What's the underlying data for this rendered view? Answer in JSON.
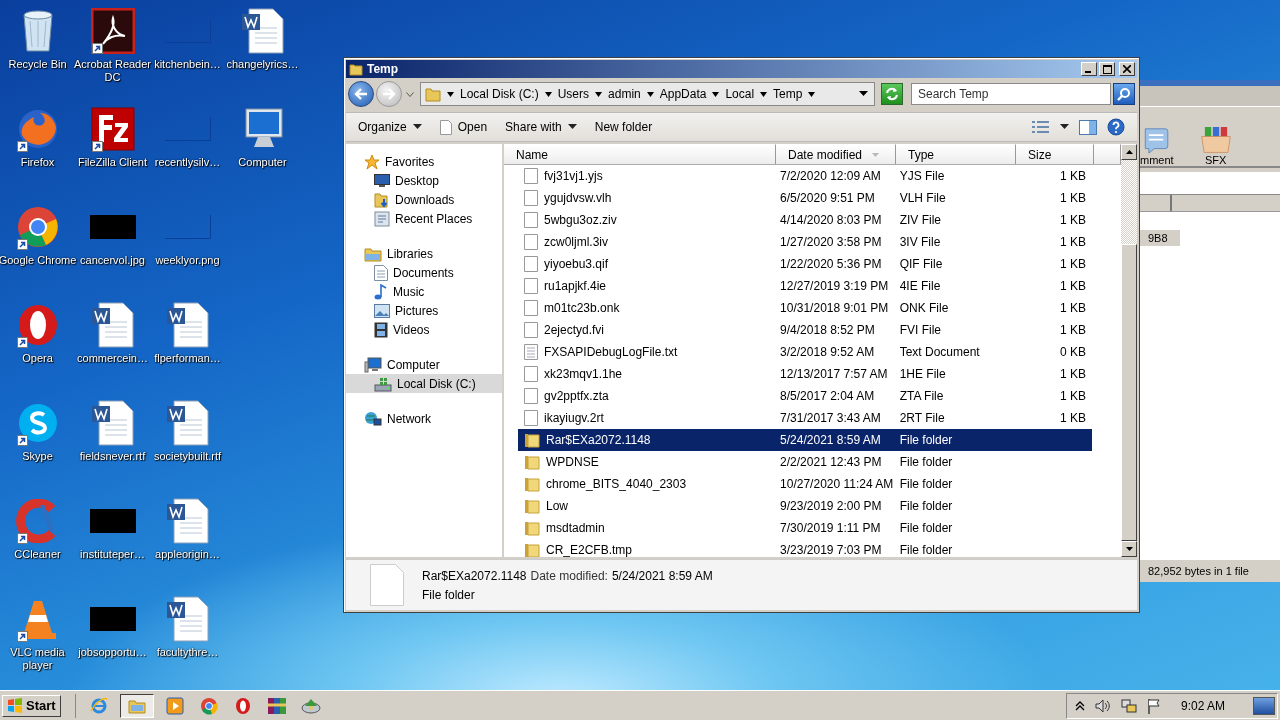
{
  "desktop": {
    "icons": [
      {
        "label": "Recycle Bin",
        "kind": "recycle",
        "shortcut": false
      },
      {
        "label": "Firefox",
        "kind": "firefox",
        "shortcut": true
      },
      {
        "label": "Google Chrome",
        "kind": "chrome",
        "shortcut": true
      },
      {
        "label": "Opera",
        "kind": "opera",
        "shortcut": true
      },
      {
        "label": "Skype",
        "kind": "skype",
        "shortcut": true
      },
      {
        "label": "CCleaner",
        "kind": "ccleaner",
        "shortcut": true
      },
      {
        "label": "VLC media player",
        "kind": "vlc",
        "shortcut": true
      },
      {
        "label": "Acrobat Reader DC",
        "kind": "pdf",
        "shortcut": true
      },
      {
        "label": "FileZilla Client",
        "kind": "filezilla",
        "shortcut": true
      },
      {
        "label": "cancervol.jpg",
        "kind": "image-dark",
        "shortcut": false
      },
      {
        "label": "commercein…",
        "kind": "word",
        "shortcut": false
      },
      {
        "label": "fieldsnever.rtf",
        "kind": "word",
        "shortcut": false
      },
      {
        "label": "instituteper…",
        "kind": "image-dark",
        "shortcut": false
      },
      {
        "label": "jobsopportu…",
        "kind": "image-dark",
        "shortcut": false
      },
      {
        "label": "kitchenbein…",
        "kind": "image-blank",
        "shortcut": false
      },
      {
        "label": "recentlysilv…",
        "kind": "image-blank",
        "shortcut": false
      },
      {
        "label": "weeklyor.png",
        "kind": "image-blank",
        "shortcut": false
      },
      {
        "label": "flperforman…",
        "kind": "word",
        "shortcut": false
      },
      {
        "label": "societybuilt.rtf",
        "kind": "word",
        "shortcut": false
      },
      {
        "label": "appleorigin…",
        "kind": "word",
        "shortcut": false
      },
      {
        "label": "facultythre…",
        "kind": "word",
        "shortcut": false
      },
      {
        "label": "changelyrics…",
        "kind": "word",
        "shortcut": false
      },
      {
        "label": "Computer",
        "kind": "computer",
        "shortcut": false
      }
    ]
  },
  "background_window": {
    "toolbar": [
      {
        "label": "mment",
        "kind": "comment"
      },
      {
        "label": "SFX",
        "kind": "sfx"
      }
    ],
    "cell": "9B8",
    "status": "82,952 bytes in 1 file"
  },
  "explorer": {
    "title": "Temp",
    "breadcrumb": [
      "Local Disk (C:)",
      "Users",
      "admin",
      "AppData",
      "Local",
      "Temp"
    ],
    "search": {
      "placeholder": "Search Temp"
    },
    "toolbar": [
      {
        "label": "Organize",
        "kind": "menu"
      },
      {
        "label": "Open",
        "kind": "open"
      },
      {
        "label": "Share with",
        "kind": "menu"
      },
      {
        "label": "New folder",
        "kind": "plain"
      }
    ],
    "nav": [
      {
        "label": "Favorites",
        "kind": "favorites",
        "selected": false,
        "children": [
          {
            "label": "Desktop",
            "kind": "desktop",
            "selected": false
          },
          {
            "label": "Downloads",
            "kind": "downloads",
            "selected": false
          },
          {
            "label": "Recent Places",
            "kind": "recent",
            "selected": false
          }
        ]
      },
      {
        "label": "Libraries",
        "kind": "libraries",
        "selected": false,
        "children": [
          {
            "label": "Documents",
            "kind": "documents",
            "selected": false
          },
          {
            "label": "Music",
            "kind": "music",
            "selected": false
          },
          {
            "label": "Pictures",
            "kind": "pictures",
            "selected": false
          },
          {
            "label": "Videos",
            "kind": "videos",
            "selected": false
          }
        ]
      },
      {
        "label": "Computer",
        "kind": "computer",
        "selected": false,
        "children": [
          {
            "label": "Local Disk (C:)",
            "kind": "disk",
            "selected": true
          }
        ]
      },
      {
        "label": "Network",
        "kind": "network",
        "selected": false
      }
    ],
    "columns": [
      {
        "label": "Name",
        "sorted": false
      },
      {
        "label": "Date modified",
        "sorted": true
      },
      {
        "label": "Type",
        "sorted": false
      },
      {
        "label": "Size",
        "sorted": false
      }
    ],
    "rows": [
      {
        "name": "fvj31vj1.yjs",
        "date": "7/2/2020 12:09 AM",
        "type": "YJS File",
        "size": "1 KB",
        "kind": "file",
        "selected": false
      },
      {
        "name": "ygujdvsw.vlh",
        "date": "6/5/2020 9:51 PM",
        "type": "VLH File",
        "size": "1 KB",
        "kind": "file",
        "selected": false
      },
      {
        "name": "5wbgu3oz.ziv",
        "date": "4/14/2020 8:03 PM",
        "type": "ZIV File",
        "size": "1 KB",
        "kind": "file",
        "selected": false
      },
      {
        "name": "zcw0ljml.3iv",
        "date": "1/27/2020 3:58 PM",
        "type": "3IV File",
        "size": "1 KB",
        "kind": "file",
        "selected": false
      },
      {
        "name": "yiyoebu3.qif",
        "date": "1/22/2020 5:36 PM",
        "type": "QIF File",
        "size": "1 KB",
        "kind": "file",
        "selected": false
      },
      {
        "name": "ru1apjkf.4ie",
        "date": "12/27/2019 3:19 PM",
        "type": "4IE File",
        "size": "1 KB",
        "kind": "file",
        "selected": false
      },
      {
        "name": "m01tc23b.onk",
        "date": "10/31/2018 9:01 PM",
        "type": "ONK File",
        "size": "1 KB",
        "kind": "file",
        "selected": false
      },
      {
        "name": "2ejectyd.fvi",
        "date": "9/4/2018 8:52 PM",
        "type": "FVI File",
        "size": "1 KB",
        "kind": "file",
        "selected": false
      },
      {
        "name": "FXSAPIDebugLogFile.txt",
        "date": "3/2/2018 9:52 AM",
        "type": "Text Document",
        "size": "0 KB",
        "kind": "text",
        "selected": false
      },
      {
        "name": "xk23mqv1.1he",
        "date": "12/13/2017 7:57 AM",
        "type": "1HE File",
        "size": "1 KB",
        "kind": "file",
        "selected": false
      },
      {
        "name": "gv2pptfx.zta",
        "date": "8/5/2017 2:04 AM",
        "type": "ZTA File",
        "size": "1 KB",
        "kind": "file",
        "selected": false
      },
      {
        "name": "ikayiugv.2rt",
        "date": "7/31/2017 3:43 AM",
        "type": "2RT File",
        "size": "1 KB",
        "kind": "file",
        "selected": false
      },
      {
        "name": "Rar$EXa2072.1148",
        "date": "5/24/2021 8:59 AM",
        "type": "File folder",
        "kind": "folder",
        "selected": true
      },
      {
        "name": "WPDNSE",
        "date": "2/2/2021 12:43 PM",
        "type": "File folder",
        "kind": "folder",
        "selected": false
      },
      {
        "name": "chrome_BITS_4040_2303",
        "date": "10/27/2020 11:24 AM",
        "type": "File folder",
        "kind": "folder",
        "selected": false
      },
      {
        "name": "Low",
        "date": "9/23/2019 2:00 PM",
        "type": "File folder",
        "kind": "folder",
        "selected": false
      },
      {
        "name": "msdtadmin",
        "date": "7/30/2019 1:11 PM",
        "type": "File folder",
        "kind": "folder",
        "selected": false
      },
      {
        "name": "CR_E2CFB.tmp",
        "date": "3/23/2019 7:03 PM",
        "type": "File folder",
        "kind": "folder",
        "selected": false
      }
    ],
    "details": {
      "name": "Rar$EXa2072.1148",
      "date_label": "Date modified:",
      "date": "5/24/2021 8:59 AM",
      "type": "File folder"
    }
  },
  "taskbar": {
    "start": "Start",
    "apps": [
      {
        "kind": "ie",
        "selected": false
      },
      {
        "kind": "explorer",
        "selected": true
      },
      {
        "kind": "media",
        "selected": false
      },
      {
        "kind": "chrome",
        "selected": false
      },
      {
        "kind": "opera",
        "selected": false
      },
      {
        "kind": "winrar",
        "selected": false
      },
      {
        "kind": "disc",
        "selected": false
      }
    ],
    "clock": "9:02 AM"
  }
}
